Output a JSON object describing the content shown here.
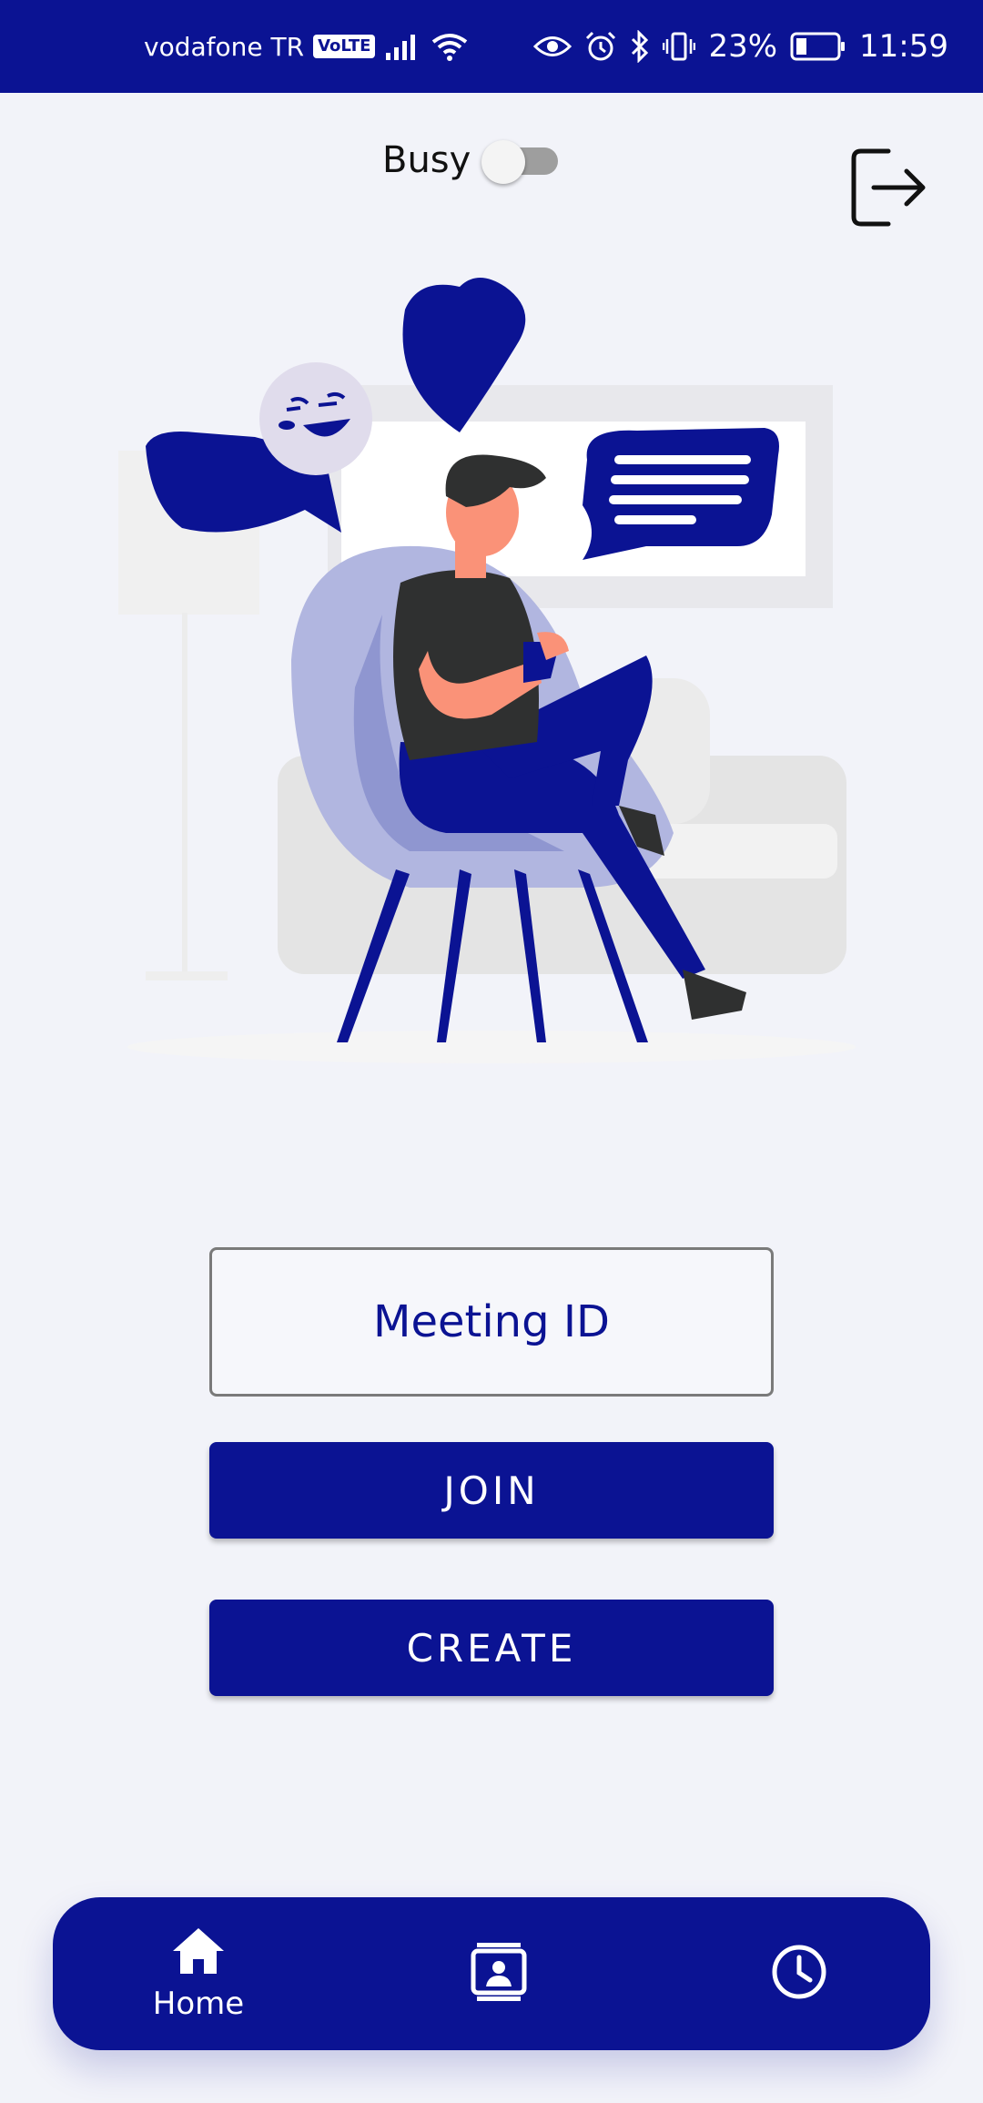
{
  "status_bar": {
    "carrier": "vodafone TR",
    "volte": "VoLTE",
    "battery": "23%",
    "time": "11:59"
  },
  "header": {
    "busy_label": "Busy",
    "busy_enabled": false
  },
  "meeting": {
    "placeholder": "Meeting ID",
    "join_label": "JOIN",
    "create_label": "CREATE"
  },
  "bottom_nav": {
    "items": [
      {
        "label": "Home",
        "icon": "home-icon",
        "active": true
      },
      {
        "label": "",
        "icon": "contacts-icon",
        "active": false
      },
      {
        "label": "",
        "icon": "clock-icon",
        "active": false
      }
    ]
  },
  "colors": {
    "primary": "#0b1393",
    "background": "#f2f3f9",
    "chair": "#b1b6e0",
    "skin": "#fa9278",
    "shirt": "#2f3030"
  }
}
